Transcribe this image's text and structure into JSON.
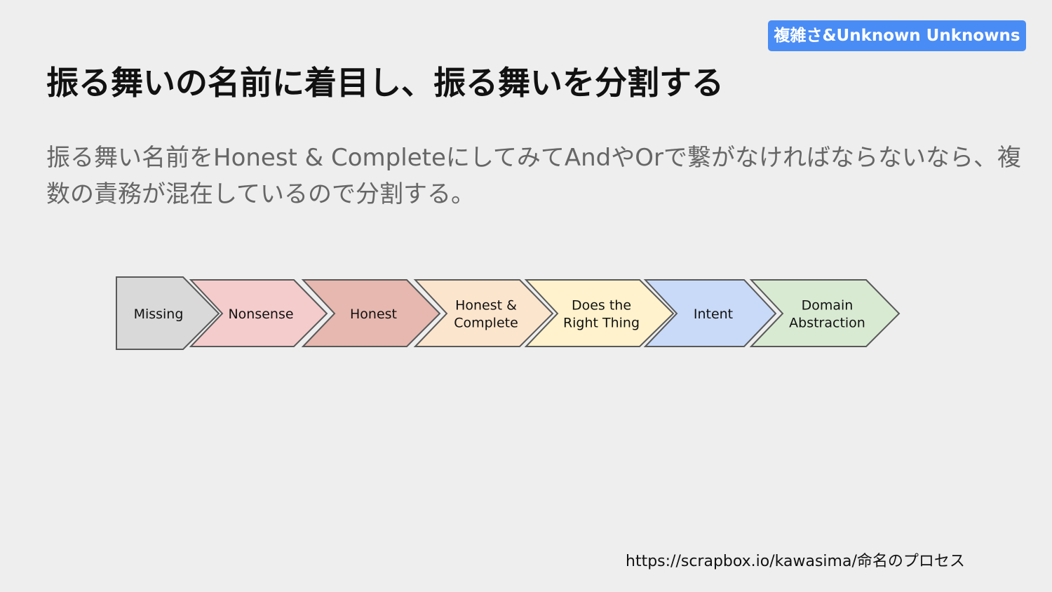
{
  "slide": {
    "tag": "複雑さ&Unknown Unknowns",
    "title": "振る舞いの名前に着目し、振る舞いを分割する",
    "description": "振る舞い名前をHonest & CompleteにしてみてAndやOrで繋がなければならないなら、複数の責務が混在しているので分割する。",
    "source": "https://scrapbox.io/kawasima/命名のプロセス"
  },
  "process": {
    "steps": [
      {
        "lines": [
          "Missing"
        ],
        "color": "#d9d9d9"
      },
      {
        "lines": [
          "Nonsense"
        ],
        "color": "#f4cccc"
      },
      {
        "lines": [
          "Honest"
        ],
        "color": "#e6b8af"
      },
      {
        "lines": [
          "Honest &",
          "Complete"
        ],
        "color": "#fce5cd"
      },
      {
        "lines": [
          "Does the",
          "Right Thing"
        ],
        "color": "#fff2cc"
      },
      {
        "lines": [
          "Intent"
        ],
        "color": "#c9daf8"
      },
      {
        "lines": [
          "Domain",
          "Abstraction"
        ],
        "color": "#d9ead3"
      }
    ],
    "stroke_color": "#595959"
  }
}
